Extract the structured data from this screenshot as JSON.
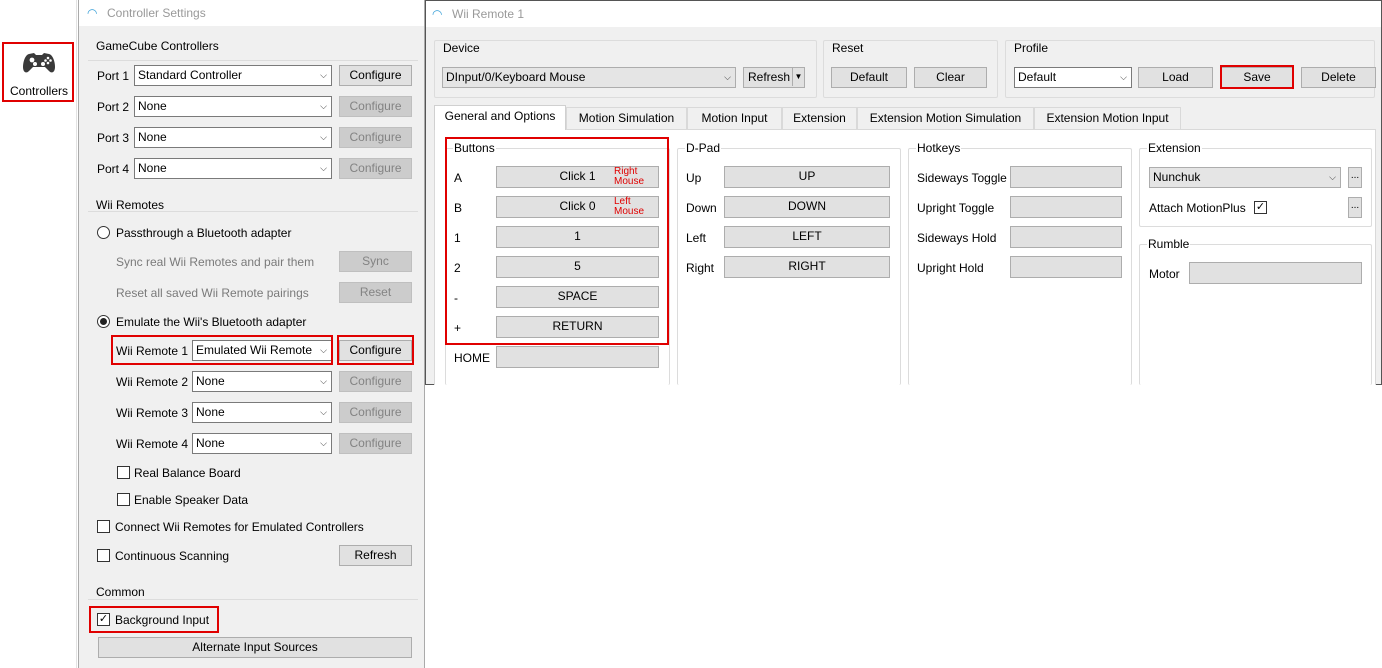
{
  "sidebar": {
    "controllers_label": "Controllers",
    "icon": "gamepad-icon"
  },
  "controller_settings": {
    "title": "Controller Settings",
    "gamecube": {
      "heading": "GameCube Controllers",
      "ports": [
        {
          "label": "Port 1",
          "value": "Standard Controller",
          "button": "Configure",
          "enabled": true
        },
        {
          "label": "Port 2",
          "value": "None",
          "button": "Configure",
          "enabled": false
        },
        {
          "label": "Port 3",
          "value": "None",
          "button": "Configure",
          "enabled": false
        },
        {
          "label": "Port 4",
          "value": "None",
          "button": "Configure",
          "enabled": false
        }
      ]
    },
    "wii": {
      "heading": "Wii Remotes",
      "passthrough_label": "Passthrough a Bluetooth adapter",
      "sync_label": "Sync real Wii Remotes and pair them",
      "sync_button": "Sync",
      "reset_label": "Reset all saved Wii Remote pairings",
      "reset_button": "Reset",
      "emulate_label": "Emulate the Wii's Bluetooth adapter",
      "remotes": [
        {
          "label": "Wii Remote 1",
          "value": "Emulated Wii Remote",
          "button": "Configure",
          "enabled": true
        },
        {
          "label": "Wii Remote 2",
          "value": "None",
          "button": "Configure",
          "enabled": false
        },
        {
          "label": "Wii Remote 3",
          "value": "None",
          "button": "Configure",
          "enabled": false
        },
        {
          "label": "Wii Remote 4",
          "value": "None",
          "button": "Configure",
          "enabled": false
        }
      ],
      "balance_board_label": "Real Balance Board",
      "speaker_label": "Enable Speaker Data",
      "connect_label": "Connect Wii Remotes for Emulated Controllers",
      "scanning_label": "Continuous Scanning",
      "refresh_button": "Refresh"
    },
    "common": {
      "heading": "Common",
      "background_input_label": "Background Input",
      "background_input_checked": true,
      "alternate_button": "Alternate Input Sources"
    }
  },
  "wii_remote_window": {
    "title": "Wii Remote 1",
    "device": {
      "heading": "Device",
      "value": "DInput/0/Keyboard Mouse",
      "refresh_button": "Refresh"
    },
    "reset": {
      "heading": "Reset",
      "default_button": "Default",
      "clear_button": "Clear"
    },
    "profile": {
      "heading": "Profile",
      "value": "Default",
      "load_button": "Load",
      "save_button": "Save",
      "delete_button": "Delete"
    },
    "tabs": [
      "General and Options",
      "Motion Simulation",
      "Motion Input",
      "Extension",
      "Extension Motion Simulation",
      "Extension Motion Input"
    ],
    "buttons": {
      "heading": "Buttons",
      "rows": [
        {
          "label": "A",
          "value": "Click 1",
          "note": "Right Mouse"
        },
        {
          "label": "B",
          "value": "Click 0",
          "note": "Left Mouse"
        },
        {
          "label": "1",
          "value": "1"
        },
        {
          "label": "2",
          "value": "5"
        },
        {
          "label": "-",
          "value": "SPACE"
        },
        {
          "label": "+",
          "value": "RETURN"
        },
        {
          "label": "HOME",
          "value": ""
        }
      ],
      "note_a": [
        "Right",
        "Mouse"
      ],
      "note_b": [
        "Left",
        "Mouse"
      ]
    },
    "dpad": {
      "heading": "D-Pad",
      "rows": [
        {
          "label": "Up",
          "value": "UP"
        },
        {
          "label": "Down",
          "value": "DOWN"
        },
        {
          "label": "Left",
          "value": "LEFT"
        },
        {
          "label": "Right",
          "value": "RIGHT"
        }
      ]
    },
    "hotkeys": {
      "heading": "Hotkeys",
      "rows": [
        {
          "label": "Sideways Toggle",
          "value": ""
        },
        {
          "label": "Upright Toggle",
          "value": ""
        },
        {
          "label": "Sideways Hold",
          "value": ""
        },
        {
          "label": "Upright Hold",
          "value": ""
        }
      ]
    },
    "extension": {
      "heading": "Extension",
      "value": "Nunchuk",
      "more_button": "...",
      "motionplus_label": "Attach MotionPlus",
      "motionplus_checked": true
    },
    "rumble": {
      "heading": "Rumble",
      "motor_label": "Motor",
      "motor_value": ""
    }
  },
  "colors": {
    "highlight": "#e00000",
    "window_bg": "#f0f0f0"
  }
}
